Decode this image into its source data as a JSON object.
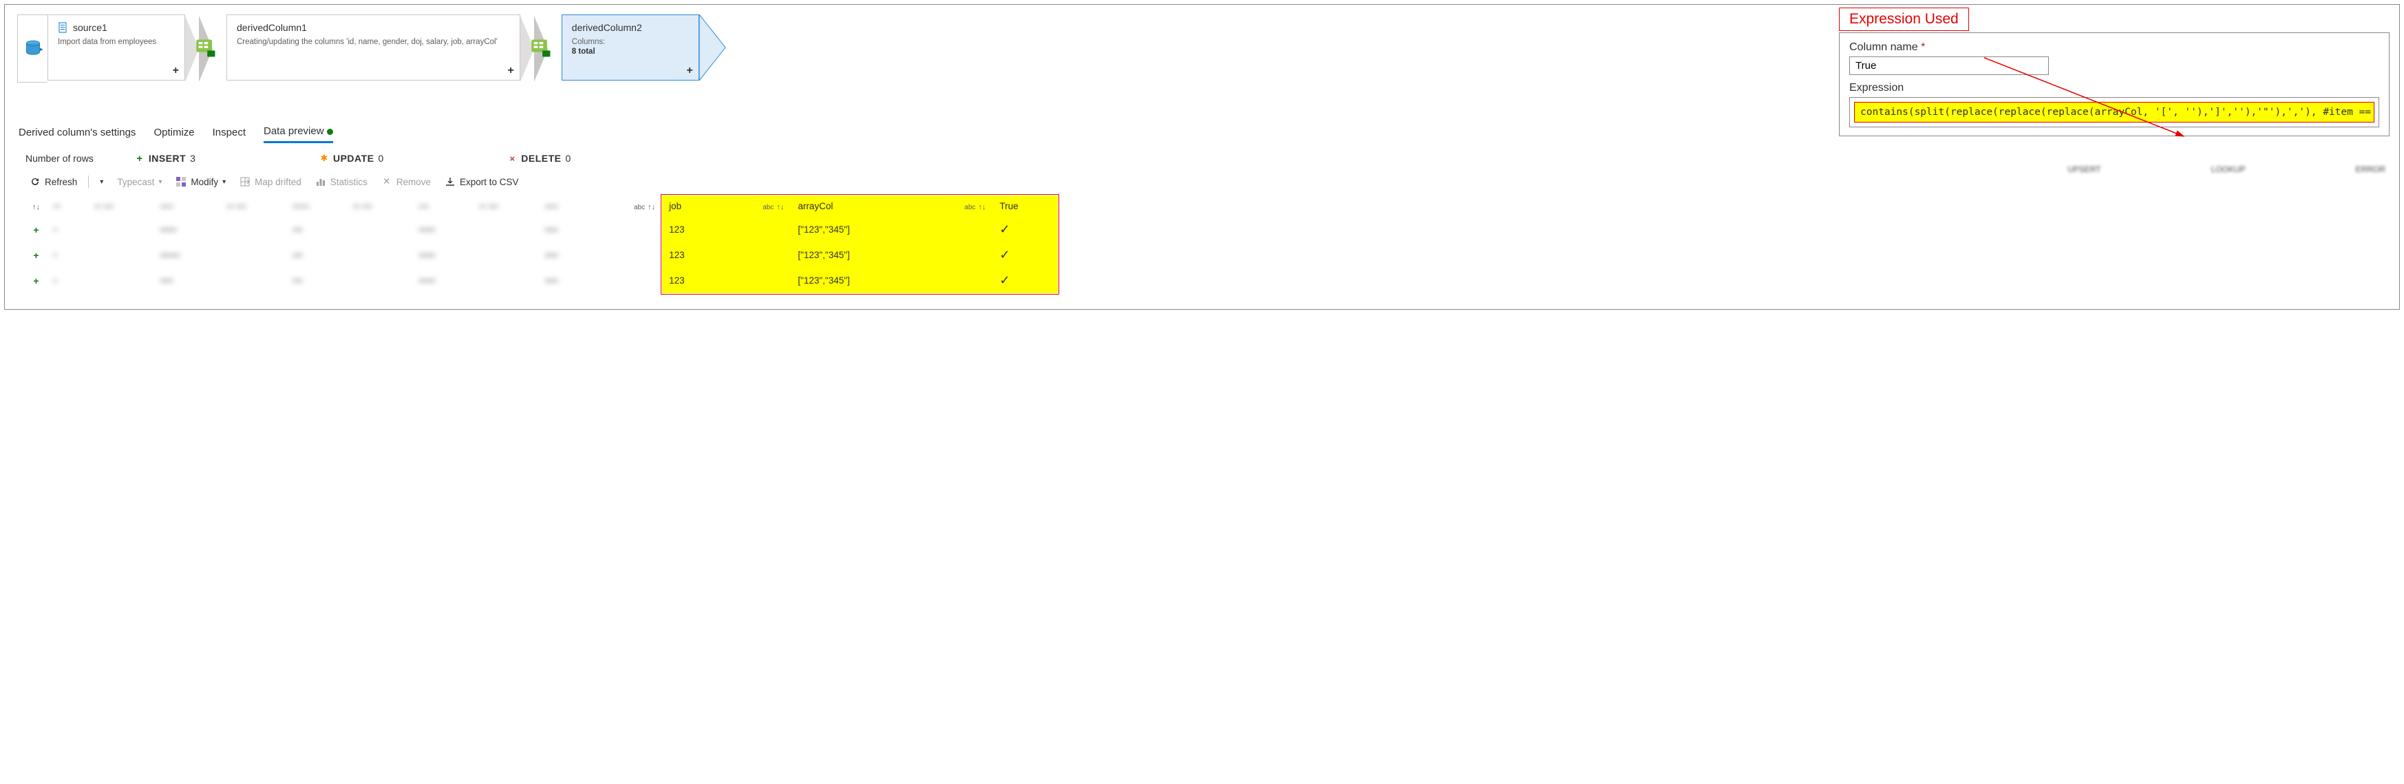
{
  "flow": {
    "source": {
      "title": "source1",
      "desc": "Import data from employees"
    },
    "dc1": {
      "title": "derivedColumn1",
      "desc": "Creating/updating the columns 'id, name, gender, doj, salary, job, arrayCol'"
    },
    "dc2": {
      "title": "derivedColumn2",
      "desc_label": "Columns:",
      "desc_value": "8 total"
    },
    "plus": "+"
  },
  "annotation": {
    "expression_used": "Expression Used"
  },
  "expr_panel": {
    "col_label": "Column name",
    "col_value": "True",
    "expr_label": "Expression",
    "expr_code": "contains(split(replace(replace(replace(arrayCol, '[', ''),']',''),'\"'),','), #item == job)"
  },
  "tabs": {
    "settings": "Derived column's settings",
    "optimize": "Optimize",
    "inspect": "Inspect",
    "preview": "Data preview"
  },
  "counts": {
    "label": "Number of rows",
    "insert_label": "INSERT",
    "insert_value": "3",
    "update_label": "UPDATE",
    "update_value": "0",
    "delete_label": "DELETE",
    "delete_value": "0"
  },
  "toolbar": {
    "refresh": "Refresh",
    "typecast": "Typecast",
    "modify": "Modify",
    "map_drifted": "Map drifted",
    "statistics": "Statistics",
    "remove": "Remove",
    "export": "Export to CSV"
  },
  "table": {
    "headers": {
      "job": "job",
      "arrayCol": "arrayCol",
      "true": "True",
      "abc": "abc"
    },
    "rows": [
      {
        "job": "123",
        "arrayCol": "[\"123\",\"345\"]",
        "true": "✓"
      },
      {
        "job": "123",
        "arrayCol": "[\"123\",\"345\"]",
        "true": "✓"
      },
      {
        "job": "123",
        "arrayCol": "[\"123\",\"345\"]",
        "true": "✓"
      }
    ]
  },
  "status_blur": {
    "a": "UPSERT",
    "b": "LOOKUP",
    "c": "ERROR"
  }
}
